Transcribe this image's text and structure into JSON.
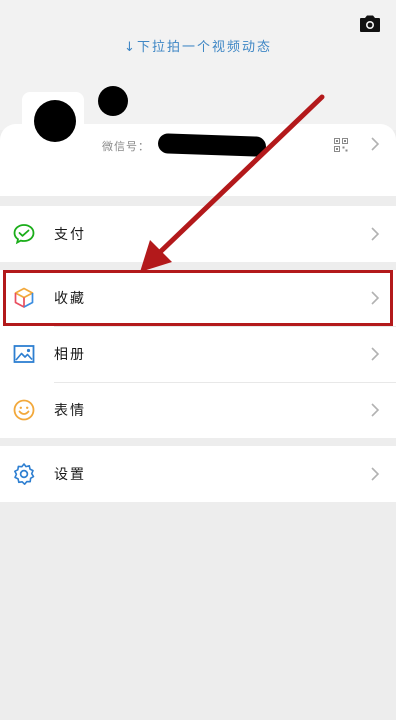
{
  "header": {
    "pull_hint": "↓下拉拍一个视频动态",
    "camera_icon": "camera-icon"
  },
  "profile": {
    "wechat_id_label": "微信号：",
    "qr_icon": "qr-code-icon",
    "chevron_icon": "chevron-right-icon"
  },
  "menu": {
    "pay": {
      "label": "支付",
      "icon": "wechat-pay-icon",
      "color": "#1aad19"
    },
    "favorites": {
      "label": "收藏",
      "icon": "cube-icon",
      "highlighted": true
    },
    "album": {
      "label": "相册",
      "icon": "image-icon",
      "color": "#2e7fd1"
    },
    "stickers": {
      "label": "表情",
      "icon": "smiley-icon",
      "color": "#f2a83b"
    },
    "settings": {
      "label": "设置",
      "icon": "gear-icon",
      "color": "#2e7fd1"
    }
  },
  "annotation": {
    "color": "#b3191b"
  }
}
